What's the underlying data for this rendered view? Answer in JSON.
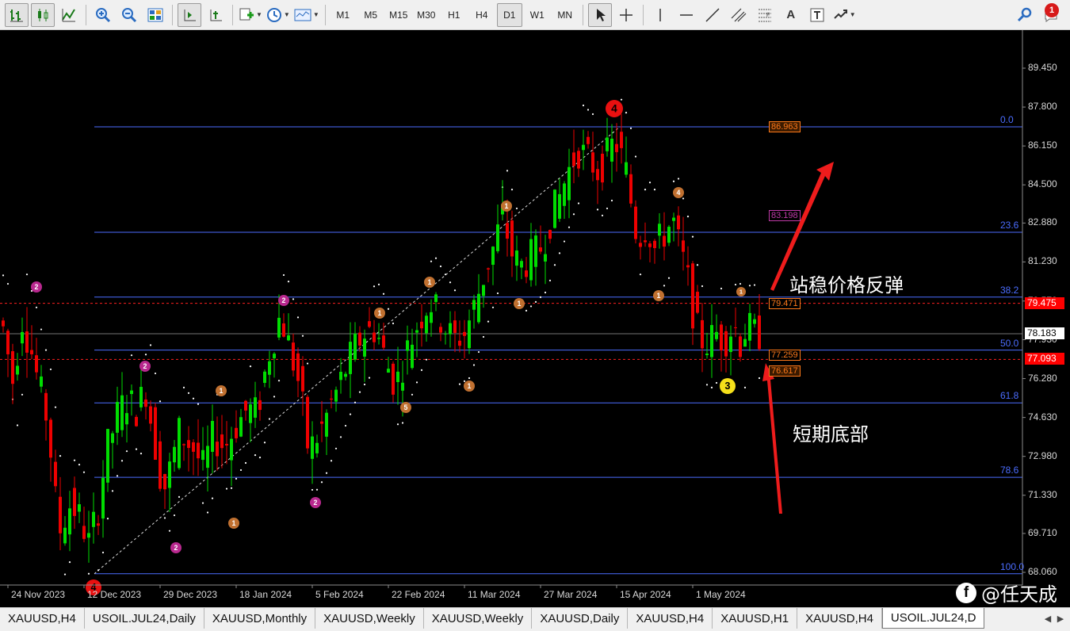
{
  "toolbar": {
    "timeframes": [
      "M1",
      "M5",
      "M15",
      "M30",
      "H1",
      "H4",
      "D1",
      "W1",
      "MN"
    ],
    "active_timeframe": "D1",
    "notification_count": "1",
    "text_tool_label": "A"
  },
  "chart": {
    "symbol": "USOIL.JUL24,Daily",
    "price_axis": [
      "89.450",
      "87.800",
      "86.150",
      "84.500",
      "82.880",
      "81.230",
      "79.570",
      "77.930",
      "76.280",
      "74.630",
      "72.980",
      "71.330",
      "69.710",
      "68.060"
    ],
    "date_axis": [
      "24 Nov 2023",
      "12 Dec 2023",
      "29 Dec 2023",
      "18 Jan 2024",
      "5 Feb 2024",
      "22 Feb 2024",
      "11 Mar 2024",
      "27 Mar 2024",
      "15 Apr 2024",
      "1 May 2024"
    ],
    "fib_levels": [
      {
        "pct": "0.0",
        "price": 86.963
      },
      {
        "pct": "23.6",
        "price": 82.49
      },
      {
        "pct": "38.2",
        "price": 79.74
      },
      {
        "pct": "50.0",
        "price": 77.49
      },
      {
        "pct": "61.8",
        "price": 75.25
      },
      {
        "pct": "78.6",
        "price": 72.09
      },
      {
        "pct": "100.0",
        "price": 68.0
      }
    ],
    "fib_value_labels": [
      {
        "value": "86.963",
        "price": 86.963,
        "color": "#ff7a1a",
        "bg": "#3a1a00"
      },
      {
        "value": "83.198",
        "price": 83.198,
        "color": "#c03aa8",
        "bg": "#000000"
      },
      {
        "value": "79.471",
        "price": 79.471,
        "color": "#ff7a1a",
        "bg": "#000000"
      },
      {
        "value": "77.259",
        "price": 77.259,
        "color": "#ff7a1a",
        "bg": "#000000"
      },
      {
        "value": "76.617",
        "price": 76.617,
        "color": "#ff7a1a",
        "bg": "#3a1a00"
      }
    ],
    "current_price_tags": [
      {
        "value": "78.183",
        "price": 78.183,
        "bg": "#ffffff",
        "fg": "#000000"
      },
      {
        "value": "79.475",
        "price": 79.475,
        "bg": "#ff0000",
        "fg": "#ffffff"
      },
      {
        "value": "77.093",
        "price": 77.093,
        "bg": "#ff0000",
        "fg": "#ffffff"
      }
    ],
    "annotations": {
      "rebound": "站稳价格反弹",
      "bottom": "短期底部"
    },
    "wave_labels": {
      "major_top": "4",
      "major_bottom": "4",
      "current": "3",
      "minor": [
        "2",
        "2",
        "2",
        "2",
        "2",
        "1",
        "1",
        "1",
        "1",
        "1",
        "1",
        "1",
        "1",
        "4",
        "5"
      ]
    },
    "watermark": "@任天成",
    "colors": {
      "bull": "#00dd00",
      "bear": "#ee0000",
      "fib": "#4b6dff",
      "arrow": "#ee1c1c"
    }
  },
  "tabs": [
    "XAUUSD,H4",
    "USOIL.JUL24,Daily",
    "XAUUSD,Monthly",
    "XAUUSD,Weekly",
    "XAUUSD,Weekly",
    "XAUUSD,Daily",
    "XAUUSD,H4",
    "XAUUSD,H1",
    "XAUUSD,H4",
    "USOIL.JUL24,D"
  ],
  "active_tab_index": 9
}
